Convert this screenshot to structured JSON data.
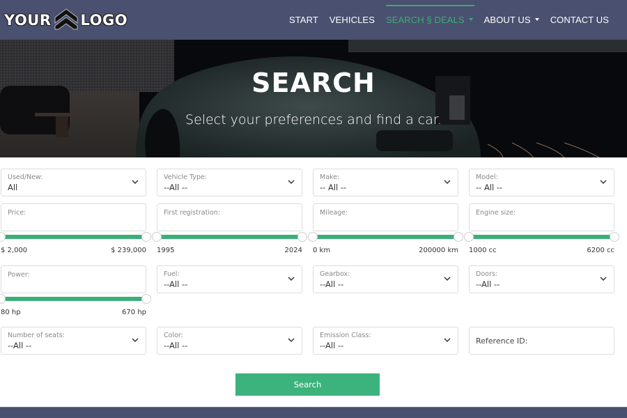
{
  "brand": {
    "logo_left": "YOUR",
    "logo_right": "LOGO"
  },
  "nav": {
    "items": [
      {
        "label": "START",
        "active": false,
        "dropdown": false
      },
      {
        "label": "VEHICLES",
        "active": false,
        "dropdown": false
      },
      {
        "label": "SEARCH § DEALS",
        "active": true,
        "dropdown": true
      },
      {
        "label": "ABOUT US",
        "active": false,
        "dropdown": true
      },
      {
        "label": "CONTACT US",
        "active": false,
        "dropdown": false
      }
    ]
  },
  "hero": {
    "title": "SEARCH",
    "subtitle": "Select your preferences and find a car."
  },
  "form": {
    "used_new": {
      "label": "Used/New:",
      "value": "All"
    },
    "vehicle_type": {
      "label": "Vehicle Type:",
      "value": "--All --"
    },
    "make": {
      "label": "Make:",
      "value": "-- All --"
    },
    "model": {
      "label": "Model:",
      "value": "-- All --"
    },
    "price": {
      "label": "Price:",
      "min_label": "$ 2,000",
      "max_label": "$ 239,000",
      "range_selected": [
        0,
        1
      ]
    },
    "first_registration": {
      "label": "First registration:",
      "min_label": "1995",
      "max_label": "2024",
      "range_selected": [
        0,
        1
      ]
    },
    "mileage": {
      "label": "Mileage:",
      "min_label": "0 km",
      "max_label": "200000 km",
      "range_selected": [
        0,
        1
      ]
    },
    "engine_size": {
      "label": "Engine size:",
      "min_label": "1000 cc",
      "max_label": "6200 cc",
      "range_selected": [
        0,
        1
      ]
    },
    "power": {
      "label": "Power:",
      "min_label": "80 hp",
      "max_label": "670 hp",
      "range_selected": [
        0,
        1
      ]
    },
    "fuel": {
      "label": "Fuel:",
      "value": "--All --"
    },
    "gearbox": {
      "label": "Gearbox:",
      "value": "--All --"
    },
    "doors": {
      "label": "Doors:",
      "value": "--All --"
    },
    "seats": {
      "label": "Number of seats:",
      "value": "--All --"
    },
    "color": {
      "label": "Color:",
      "value": "--All --"
    },
    "emission_class": {
      "label": "Emission Class:",
      "value": "--All --"
    },
    "reference_id": {
      "label": "Reference ID:",
      "value": ""
    },
    "search_label": "Search"
  },
  "colors": {
    "navbar": "#4a506f",
    "accent": "#3aaf78",
    "button": "#3cb27c"
  }
}
